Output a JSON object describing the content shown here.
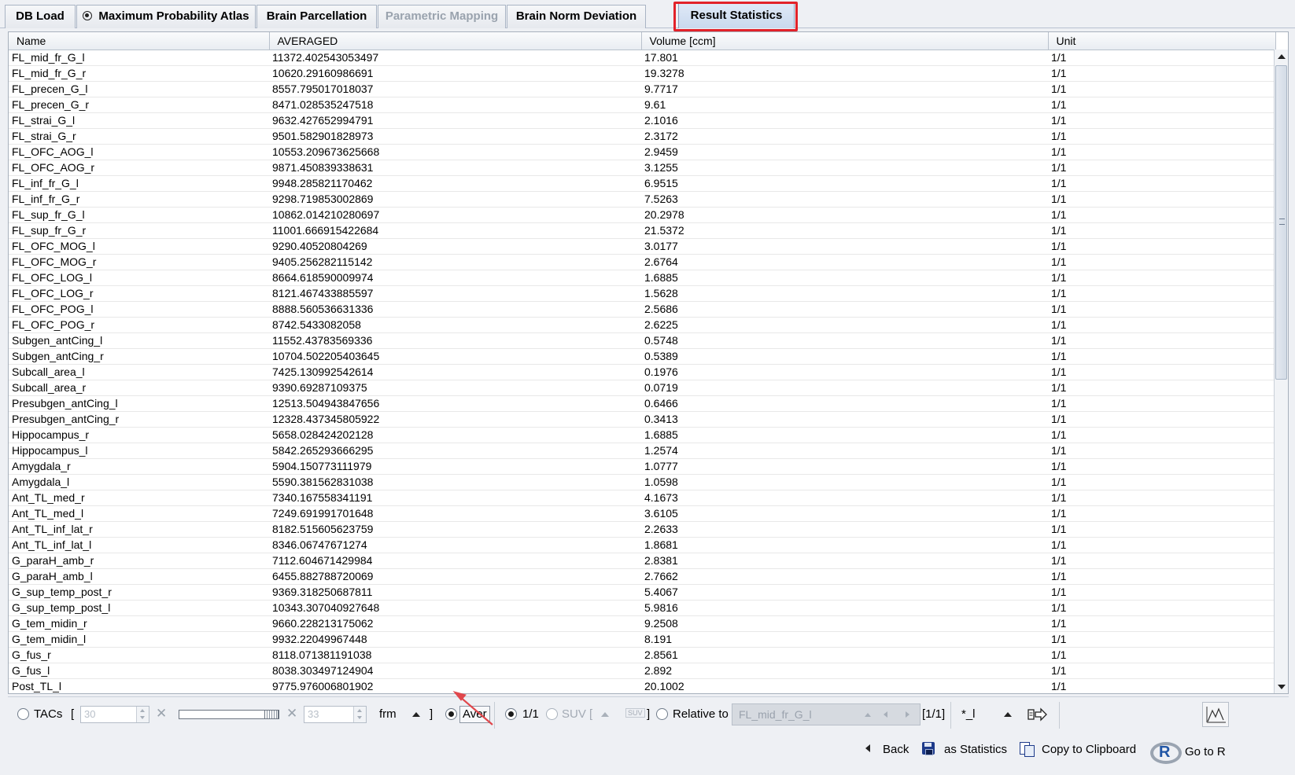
{
  "tabs": [
    {
      "label": "DB Load",
      "state": "normal"
    },
    {
      "label": "Maximum Probability Atlas",
      "state": "normal",
      "icon": "atlas-icon"
    },
    {
      "label": "Brain Parcellation",
      "state": "normal"
    },
    {
      "label": "Parametric Mapping",
      "state": "disabled"
    },
    {
      "label": "Brain Norm Deviation",
      "state": "normal"
    },
    {
      "label": "Result Statistics",
      "state": "active"
    }
  ],
  "table": {
    "columns": [
      "Name",
      "AVERAGED",
      "Volume [ccm]",
      "Unit"
    ],
    "rows": [
      [
        "FL_mid_fr_G_l",
        "11372.402543053497",
        "17.801",
        "1/1"
      ],
      [
        "FL_mid_fr_G_r",
        "10620.29160986691",
        "19.3278",
        "1/1"
      ],
      [
        "FL_precen_G_l",
        "8557.795017018037",
        "9.7717",
        "1/1"
      ],
      [
        "FL_precen_G_r",
        "8471.028535247518",
        "9.61",
        "1/1"
      ],
      [
        "FL_strai_G_l",
        "9632.427652994791",
        "2.1016",
        "1/1"
      ],
      [
        "FL_strai_G_r",
        "9501.582901828973",
        "2.3172",
        "1/1"
      ],
      [
        "FL_OFC_AOG_l",
        "10553.209673625668",
        "2.9459",
        "1/1"
      ],
      [
        "FL_OFC_AOG_r",
        "9871.450839338631",
        "3.1255",
        "1/1"
      ],
      [
        "FL_inf_fr_G_l",
        "9948.285821170462",
        "6.9515",
        "1/1"
      ],
      [
        "FL_inf_fr_G_r",
        "9298.719853002869",
        "7.5263",
        "1/1"
      ],
      [
        "FL_sup_fr_G_l",
        "10862.014210280697",
        "20.2978",
        "1/1"
      ],
      [
        "FL_sup_fr_G_r",
        "11001.666915422684",
        "21.5372",
        "1/1"
      ],
      [
        "FL_OFC_MOG_l",
        "9290.40520804269",
        "3.0177",
        "1/1"
      ],
      [
        "FL_OFC_MOG_r",
        "9405.256282115142",
        "2.6764",
        "1/1"
      ],
      [
        "FL_OFC_LOG_l",
        "8664.618590009974",
        "1.6885",
        "1/1"
      ],
      [
        "FL_OFC_LOG_r",
        "8121.467433885597",
        "1.5628",
        "1/1"
      ],
      [
        "FL_OFC_POG_l",
        "8888.560536631336",
        "2.5686",
        "1/1"
      ],
      [
        "FL_OFC_POG_r",
        "8742.5433082058",
        "2.6225",
        "1/1"
      ],
      [
        "Subgen_antCing_l",
        "11552.43783569336",
        "0.5748",
        "1/1"
      ],
      [
        "Subgen_antCing_r",
        "10704.502205403645",
        "0.5389",
        "1/1"
      ],
      [
        "Subcall_area_l",
        "7425.130992542614",
        "0.1976",
        "1/1"
      ],
      [
        "Subcall_area_r",
        "9390.69287109375",
        "0.0719",
        "1/1"
      ],
      [
        "Presubgen_antCing_l",
        "12513.504943847656",
        "0.6466",
        "1/1"
      ],
      [
        "Presubgen_antCing_r",
        "12328.437345805922",
        "0.3413",
        "1/1"
      ],
      [
        "Hippocampus_r",
        "5658.028424202128",
        "1.6885",
        "1/1"
      ],
      [
        "Hippocampus_l",
        "5842.265293666295",
        "1.2574",
        "1/1"
      ],
      [
        "Amygdala_r",
        "5904.150773111979",
        "1.0777",
        "1/1"
      ],
      [
        "Amygdala_l",
        "5590.381562831038",
        "1.0598",
        "1/1"
      ],
      [
        "Ant_TL_med_r",
        "7340.167558341191",
        "4.1673",
        "1/1"
      ],
      [
        "Ant_TL_med_l",
        "7249.691991701648",
        "3.6105",
        "1/1"
      ],
      [
        "Ant_TL_inf_lat_r",
        "8182.515605623759",
        "2.2633",
        "1/1"
      ],
      [
        "Ant_TL_inf_lat_l",
        "8346.06747671274",
        "1.8681",
        "1/1"
      ],
      [
        "G_paraH_amb_r",
        "7112.604671429984",
        "2.8381",
        "1/1"
      ],
      [
        "G_paraH_amb_l",
        "6455.882788720069",
        "2.7662",
        "1/1"
      ],
      [
        "G_sup_temp_post_r",
        "9369.318250687811",
        "5.4067",
        "1/1"
      ],
      [
        "G_sup_temp_post_l",
        "10343.307040927648",
        "5.9816",
        "1/1"
      ],
      [
        "G_tem_midin_r",
        "9660.228213175062",
        "9.2508",
        "1/1"
      ],
      [
        "G_tem_midin_l",
        "9932.22049967448",
        "8.191",
        "1/1"
      ],
      [
        "G_fus_r",
        "8118.071381191038",
        "2.8561",
        "1/1"
      ],
      [
        "G_fus_l",
        "8038.303497124904",
        "2.892",
        "1/1"
      ],
      [
        "Post_TL_l",
        "9775.976006801902",
        "20.1002",
        "1/1"
      ]
    ]
  },
  "controls": {
    "tacs_label": "TACs",
    "bracket_open": "[",
    "bracket_close": "]",
    "frame_start": "30",
    "frame_end": "33",
    "frm_label": "frm",
    "aver_label": "Aver",
    "unit_label": "1/1",
    "suv_label": "SUV [",
    "suv_close": "]",
    "relative_label": "Relative to",
    "relative_value": "FL_mid_fr_G_l",
    "relative_count": "[1/1]",
    "pattern": "*_l"
  },
  "actions": {
    "back": "Back",
    "save": "as Statistics",
    "copy": "Copy to Clipboard",
    "go_r": "Go to R"
  },
  "colors": {
    "highlight": "#e2222a",
    "annotation_arrow": "#e0474c"
  }
}
